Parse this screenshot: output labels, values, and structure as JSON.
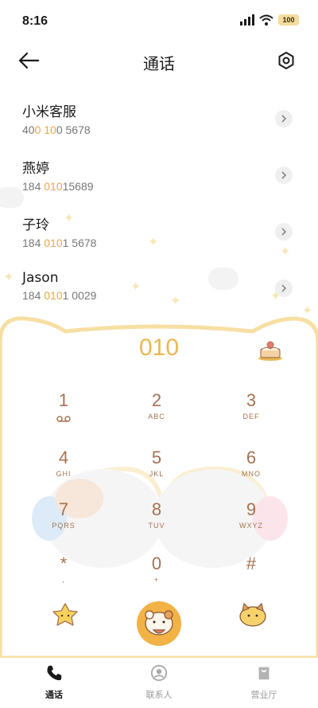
{
  "status": {
    "time": "8:16",
    "battery": "100"
  },
  "header": {
    "title": "通话"
  },
  "contacts": [
    {
      "name": "小米客服",
      "number_parts": [
        "40",
        "0",
        " ",
        "10",
        "0 5678"
      ],
      "hl": [
        false,
        true,
        false,
        true,
        false
      ]
    },
    {
      "name": "燕婷",
      "number_parts": [
        "184 ",
        "010",
        "15689"
      ],
      "hl": [
        false,
        true,
        false
      ]
    },
    {
      "name": "子玲",
      "number_parts": [
        "184 ",
        "010",
        "1 5678"
      ],
      "hl": [
        false,
        true,
        false
      ]
    },
    {
      "name": "Jason",
      "number_parts": [
        "184 ",
        "010",
        "1 0029"
      ],
      "hl": [
        false,
        true,
        false
      ]
    }
  ],
  "dialer": {
    "number": "010",
    "keys": [
      {
        "digit": "1",
        "letters": ""
      },
      {
        "digit": "2",
        "letters": "ABC"
      },
      {
        "digit": "3",
        "letters": "DEF"
      },
      {
        "digit": "4",
        "letters": "GHI"
      },
      {
        "digit": "5",
        "letters": "JKL"
      },
      {
        "digit": "6",
        "letters": "MNO"
      },
      {
        "digit": "7",
        "letters": "PQRS"
      },
      {
        "digit": "8",
        "letters": "TUV"
      },
      {
        "digit": "9",
        "letters": "WXYZ"
      },
      {
        "digit": "*",
        "letters": ","
      },
      {
        "digit": "0",
        "letters": "+"
      },
      {
        "digit": "#",
        "letters": ""
      }
    ]
  },
  "tabs": [
    {
      "label": "通话",
      "icon": "phone-icon"
    },
    {
      "label": "联系人",
      "icon": "contact-icon"
    },
    {
      "label": "营业厅",
      "icon": "store-icon"
    }
  ],
  "colors": {
    "accent": "#e9b851",
    "key_text": "#a57252",
    "call_button": "#f2b246"
  }
}
